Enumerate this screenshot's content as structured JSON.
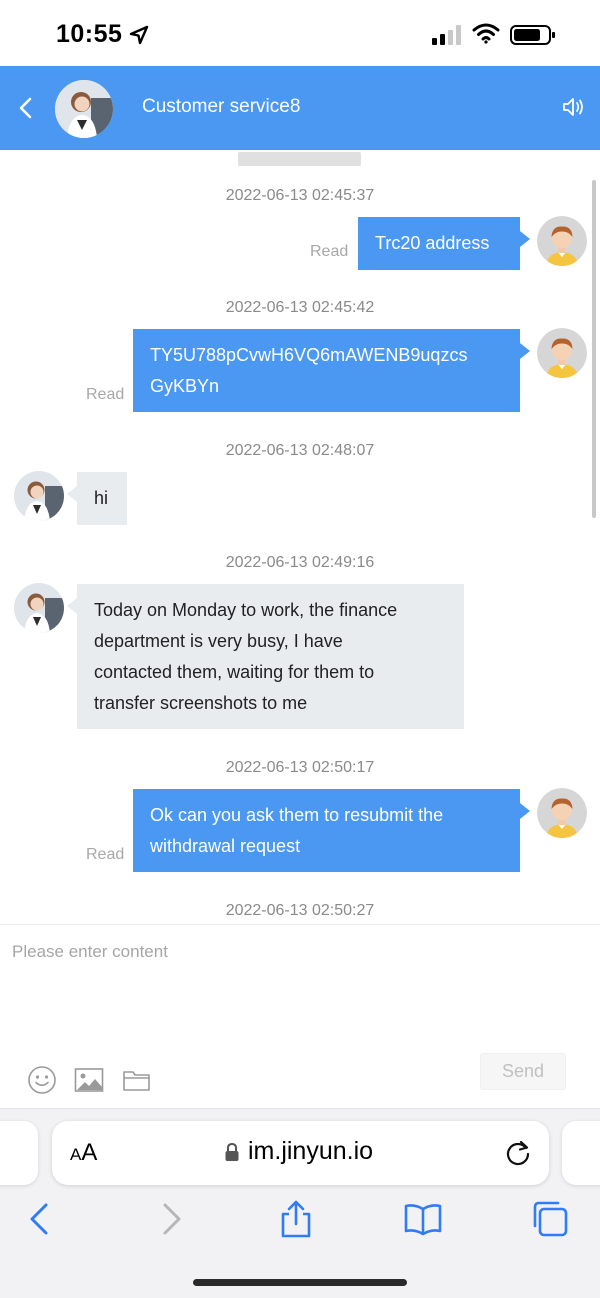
{
  "status_bar": {
    "time": "10:55"
  },
  "header": {
    "title": "Customer service8"
  },
  "messages": [
    {
      "timestamp": "2022-06-13 02:45:37",
      "direction": "out",
      "lines": [
        "Trc20 address"
      ],
      "status": "Read"
    },
    {
      "timestamp": "2022-06-13 02:45:42",
      "direction": "out",
      "lines": [
        "TY5U788pCvwH6VQ6mAWENB9uqzcs",
        "GyKBYn"
      ],
      "status": "Read"
    },
    {
      "timestamp": "2022-06-13 02:48:07",
      "direction": "in",
      "lines": [
        "hi"
      ]
    },
    {
      "timestamp": "2022-06-13 02:49:16",
      "direction": "in",
      "lines": [
        "Today on Monday to work, the finance",
        "department is very busy, I have",
        "contacted them, waiting for them to",
        "transfer screenshots to me"
      ]
    },
    {
      "timestamp": "2022-06-13 02:50:17",
      "direction": "out",
      "lines": [
        "Ok can you ask them to resubmit the",
        "withdrawal request"
      ],
      "status": "Read"
    },
    {
      "timestamp": "2022-06-13 02:50:27"
    }
  ],
  "composer": {
    "placeholder": "Please enter content",
    "send_label": "Send"
  },
  "browser": {
    "aa_label_small": "A",
    "aa_label_large": "A",
    "url": "im.jinyun.io"
  },
  "colors": {
    "accent": "#4a98f2",
    "incoming_bubble": "#e8ecee"
  }
}
